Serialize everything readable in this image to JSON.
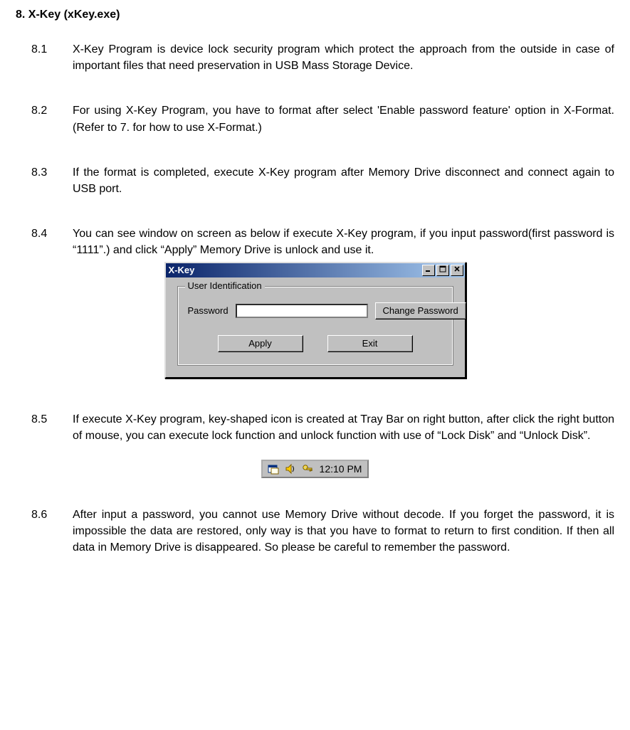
{
  "heading": "8. X-Key (xKey.exe)",
  "sections": {
    "s1": {
      "num": "8.1",
      "text": "X-Key Program is device lock security program which protect the approach from the outside in case of important files that need preservation in USB Mass Storage Device."
    },
    "s2": {
      "num": "8.2",
      "text": "For using X-Key Program, you have to format after select 'Enable password feature' option in X-Format. (Refer to 7. for how to use X-Format.)"
    },
    "s3": {
      "num": "8.3",
      "text": "If the format is completed, execute X-Key program after Memory Drive disconnect and connect again to USB port."
    },
    "s4": {
      "num": "8.4",
      "text": "You can see window on screen as below if execute X-Key program, if you input password(first password is “1111”.) and click “Apply” Memory Drive is unlock and use it."
    },
    "s5": {
      "num": "8.5",
      "text": "If execute X-Key program, key-shaped icon is created at Tray Bar on right button, after click the right button of mouse, you can execute lock function and unlock function with use of “Lock Disk” and “Unlock Disk”."
    },
    "s6": {
      "num": "8.6",
      "text": "After input a password, you cannot use Memory Drive without decode. If you forget the password, it is impossible the data are restored, only way is that you have to format to return to first condition. If then all data in Memory Drive is disappeared. So please be careful to remember the password."
    }
  },
  "dialog": {
    "title": "X-Key",
    "group_label": "User Identification",
    "password_label": "Password",
    "password_value": "",
    "change_btn": "Change Password",
    "apply_btn": "Apply",
    "exit_btn": "Exit",
    "icons": {
      "minimize": "minimize-icon",
      "maximize": "maximize-icon",
      "close": "close-icon"
    }
  },
  "tray": {
    "time": "12:10 PM",
    "icons": {
      "sys1": "system-tray-icon",
      "speaker": "speaker-icon",
      "key": "key-icon"
    }
  }
}
